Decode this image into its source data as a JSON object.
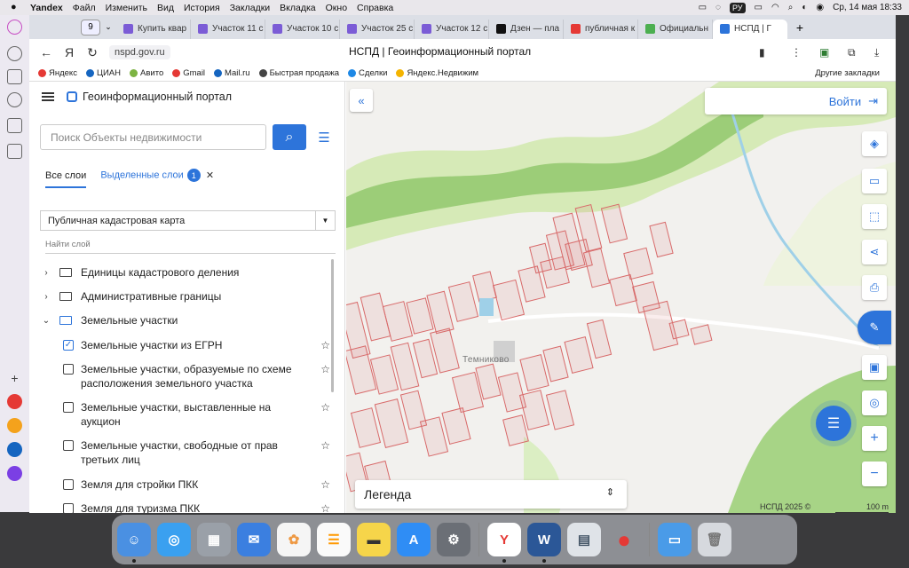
{
  "menubar": {
    "app": "Yandex",
    "items": [
      "Файл",
      "Изменить",
      "Вид",
      "История",
      "Закладки",
      "Вкладка",
      "Окно",
      "Справка"
    ],
    "input_badge": "РУ",
    "datetime": "Ср, 14 мая  18:33"
  },
  "tabs": {
    "count": "9",
    "items": [
      {
        "label": "Купить квар",
        "color": "#7b5cd6"
      },
      {
        "label": "Участок 11 с",
        "color": "#7b5cd6"
      },
      {
        "label": "Участок 10 с",
        "color": "#7b5cd6"
      },
      {
        "label": "Участок 25 с",
        "color": "#7b5cd6"
      },
      {
        "label": "Участок 12 с",
        "color": "#7b5cd6"
      },
      {
        "label": "Дзен — пла",
        "color": "#111111"
      },
      {
        "label": "публичная к",
        "color": "#e53935"
      },
      {
        "label": "Официальн",
        "color": "#4caf50"
      },
      {
        "label": "НСПД | Г",
        "color": "#2d74da"
      }
    ]
  },
  "address": {
    "url": "nspd.gov.ru",
    "title": "НСПД | Геоинформационный портал"
  },
  "bookmarks": {
    "items": [
      {
        "label": "Яндекс",
        "color": "#e53935"
      },
      {
        "label": "ЦИАН",
        "color": "#1565c0"
      },
      {
        "label": "Авито",
        "color": "#7cb342"
      },
      {
        "label": "Gmail",
        "color": "#e53935"
      },
      {
        "label": "Mail.ru",
        "color": "#1565c0"
      },
      {
        "label": "Быстрая продажа",
        "color": "#444444"
      },
      {
        "label": "Сделки",
        "color": "#1e88e5"
      },
      {
        "label": "Яндекс.Недвижим",
        "color": "#f4b400"
      }
    ],
    "other": "Другие закладки"
  },
  "sidebar": {
    "title": "Геоинформационный портал",
    "search_placeholder": "Поиск Объекты недвижимости",
    "tab_all": "Все слои",
    "tab_selected": "Выделенные слои",
    "selected_count": "1",
    "map_select": "Публичная кадастровая карта",
    "find_layer": "Найти слой",
    "groups": [
      "Единицы кадастрового деления",
      "Административные границы",
      "Земельные участки"
    ],
    "layers": [
      {
        "label": "Земельные участки из ЕГРН",
        "checked": true
      },
      {
        "label": "Земельные участки, образуемые по схеме расположения земельного участка",
        "checked": false
      },
      {
        "label": "Земельные участки, выставленные на аукцион",
        "checked": false
      },
      {
        "label": "Земельные участки, свободные от прав третьих лиц",
        "checked": false
      },
      {
        "label": "Земля для стройки ПКК",
        "checked": false
      },
      {
        "label": "Земля для туризма ПКК",
        "checked": false
      }
    ]
  },
  "map": {
    "login_label": "Войти",
    "place_label": "Темниково",
    "legend_label": "Легенда",
    "copyright": "НСПД 2025 ©",
    "scale": "100 m",
    "colors": {
      "parcel": "#d86a6a",
      "forest": "#b5d98a",
      "forest_dark": "#8ec56b",
      "river": "#9fd0e8"
    }
  }
}
